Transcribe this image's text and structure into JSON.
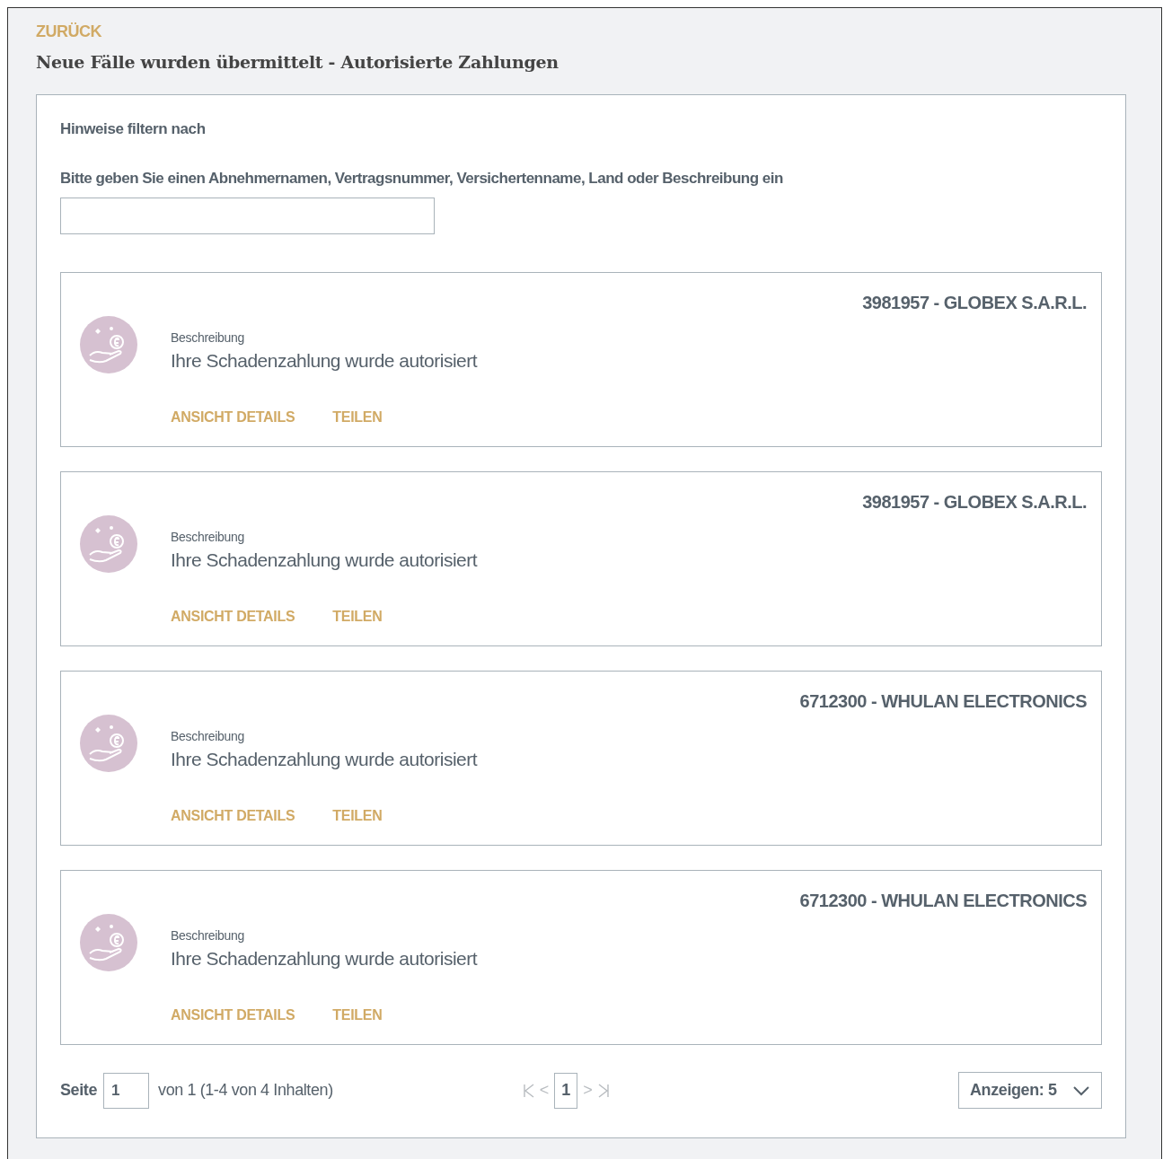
{
  "back_link": "ZURÜCK",
  "title": "Neue Fälle wurden übermittelt - Autorisierte Zahlungen",
  "filter": {
    "heading": "Hinweise filtern nach",
    "label": "Bitte geben Sie einen Abnehmernamen, Vertragsnummer, Versichertenname, Land oder Beschreibung ein"
  },
  "notices": [
    {
      "reference": "3981957 - GLOBEX S.A.R.L.",
      "description_label": "Beschreibung",
      "description": "Ihre Schadenzahlung wurde autorisiert",
      "actions": [
        "ANSICHT DETAILS",
        "TEILEN"
      ]
    },
    {
      "reference": "3981957 - GLOBEX S.A.R.L.",
      "description_label": "Beschreibung",
      "description": "Ihre Schadenzahlung wurde autorisiert",
      "actions": [
        "ANSICHT DETAILS",
        "TEILEN"
      ]
    },
    {
      "reference": "6712300 - WHULAN ELECTRONICS",
      "description_label": "Beschreibung",
      "description": "Ihre Schadenzahlung wurde autorisiert",
      "actions": [
        "ANSICHT DETAILS",
        "TEILEN"
      ]
    },
    {
      "reference": "6712300 - WHULAN ELECTRONICS",
      "description_label": "Beschreibung",
      "description": "Ihre Schadenzahlung wurde autorisiert",
      "actions": [
        "ANSICHT DETAILS",
        "TEILEN"
      ]
    }
  ],
  "pagination": {
    "page_label": "Seite",
    "page_value": "1",
    "summary": "von 1 (1-4 von 4 Inhalten)",
    "prev": "<",
    "pages": [
      {
        "label": "1",
        "selected": true
      }
    ],
    "next": ">",
    "page_size": "Anzeigen: 5"
  }
}
